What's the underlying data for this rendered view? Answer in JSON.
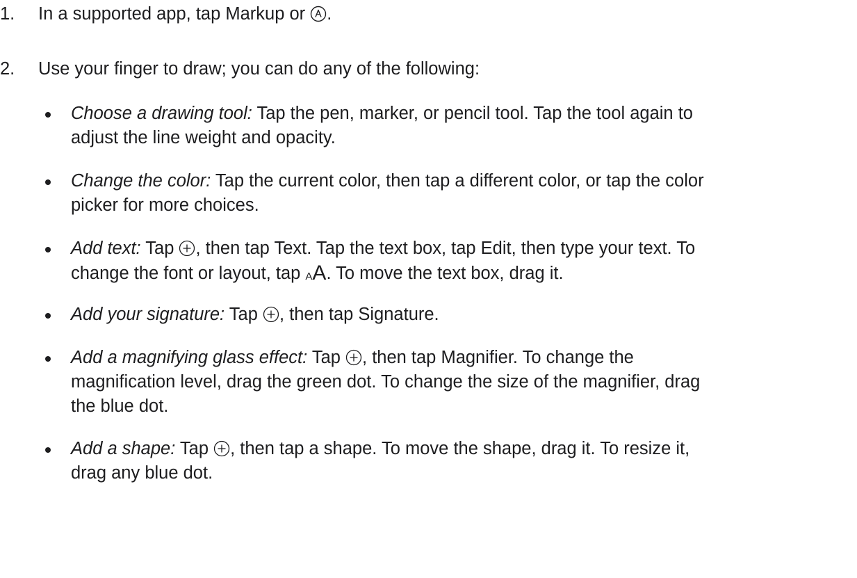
{
  "steps": [
    {
      "number": "1.",
      "text_before": "In a supported app, tap Markup or ",
      "icon": "markup-pen-icon",
      "text_after": "."
    },
    {
      "number": "2.",
      "text": "Use your finger to draw; you can do any of the following:"
    }
  ],
  "bullets": [
    {
      "term": "Choose a drawing tool:",
      "lines": [
        " Tap the pen, marker, or pencil tool. Tap the tool again to",
        "adjust the line weight and opacity."
      ]
    },
    {
      "term": "Change the color:",
      "lines": [
        " Tap the current color, then tap a different color, or tap the color",
        "picker for more choices."
      ]
    },
    {
      "term": "Add text:",
      "line1_a": " Tap ",
      "line1_b": ", then tap Text. Tap the text box, tap Edit, then type your text. To",
      "line2_a": "change the font or layout, tap ",
      "line2_b": ". To move the text box, drag it.",
      "font_icon_small": "A",
      "font_icon_big": "A"
    },
    {
      "term": "Add your signature:",
      "line1_a": " Tap ",
      "line1_b": ", then tap Signature."
    },
    {
      "term": "Add a magnifying glass effect:",
      "line1_a": " Tap ",
      "line1_b": ", then tap Magnifier. To change the",
      "lines": [
        "magnification level, drag the green dot. To change the size of the magnifier, drag",
        "the blue dot."
      ]
    },
    {
      "term": "Add a shape:",
      "line1_a": " Tap ",
      "line1_b": ", then tap a shape. To move the shape, drag it. To resize it,",
      "lines": [
        "drag any blue dot."
      ]
    }
  ],
  "icons": {
    "add": "plus-circle-icon",
    "markup": "markup-pen-icon",
    "font": "font-size-icon"
  }
}
